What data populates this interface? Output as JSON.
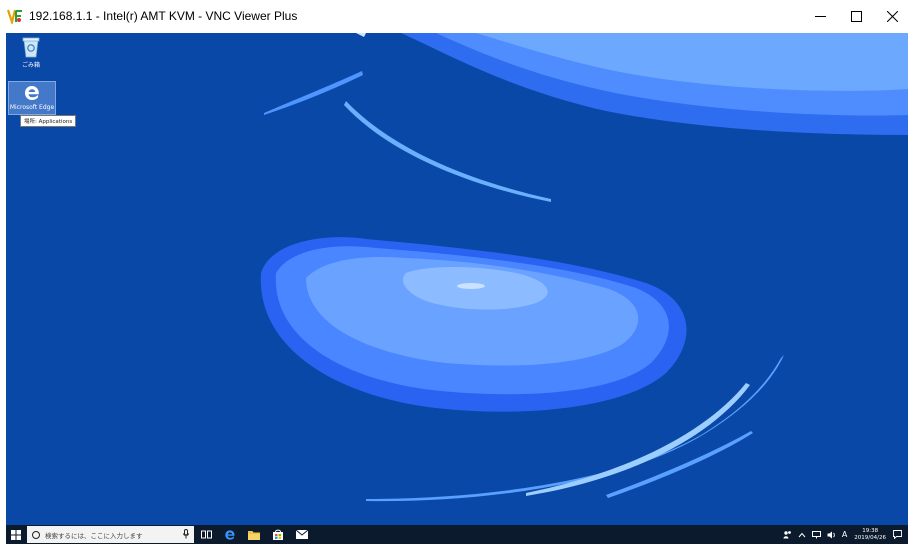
{
  "window": {
    "title": "192.168.1.1 - Intel(r) AMT KVM - VNC Viewer Plus",
    "controls": [
      "minimize",
      "maximize",
      "close"
    ]
  },
  "desktop": {
    "icons": [
      {
        "label": "ごみ箱",
        "icon": "recycle-bin-icon"
      },
      {
        "label": "Microsoft Edge",
        "icon": "edge-icon"
      }
    ],
    "tooltip": "場所: Applications",
    "wallpaper_colors": {
      "base": "#0a48a8",
      "light": "#3f8cff",
      "bright": "#6ba9ff",
      "pale": "#9fcfff"
    }
  },
  "taskbar": {
    "search_placeholder": "検索するには、ここに入力します",
    "pinned": [
      "task-view-icon",
      "edge-icon",
      "file-explorer-icon",
      "store-icon",
      "mail-icon"
    ],
    "tray": {
      "ime_label": "A",
      "time": "19:38",
      "date": "2019/04/26"
    }
  }
}
